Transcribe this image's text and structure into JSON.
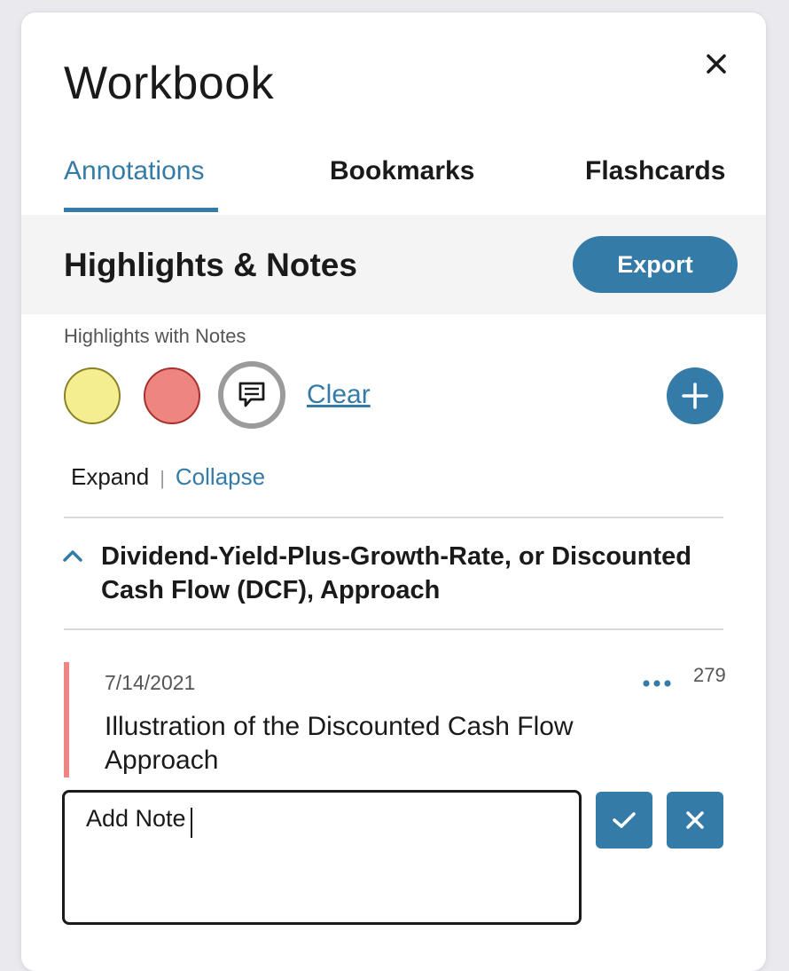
{
  "header": {
    "title": "Workbook"
  },
  "tabs": [
    {
      "label": "Annotations",
      "active": true
    },
    {
      "label": "Bookmarks",
      "active": false
    },
    {
      "label": "Flashcards",
      "active": false
    }
  ],
  "highlights": {
    "title": "Highlights & Notes",
    "export_label": "Export",
    "filter_label": "Highlights with Notes",
    "clear_label": "Clear",
    "swatches": [
      {
        "name": "yellow",
        "color": "#f5ee90"
      },
      {
        "name": "red",
        "color": "#ee8580"
      }
    ],
    "expand_label": "Expand",
    "separator": "|",
    "collapse_label": "Collapse"
  },
  "section": {
    "title": "Dividend-Yield-Plus-Growth-Rate, or Discounted Cash Flow (DCF), Approach"
  },
  "note": {
    "date": "7/14/2021",
    "page": "279",
    "text": "Illustration of the Discounted Cash Flow Approach",
    "input_placeholder": "Add Note",
    "highlight_color": "#ee8580"
  },
  "colors": {
    "accent": "#357ba7"
  }
}
